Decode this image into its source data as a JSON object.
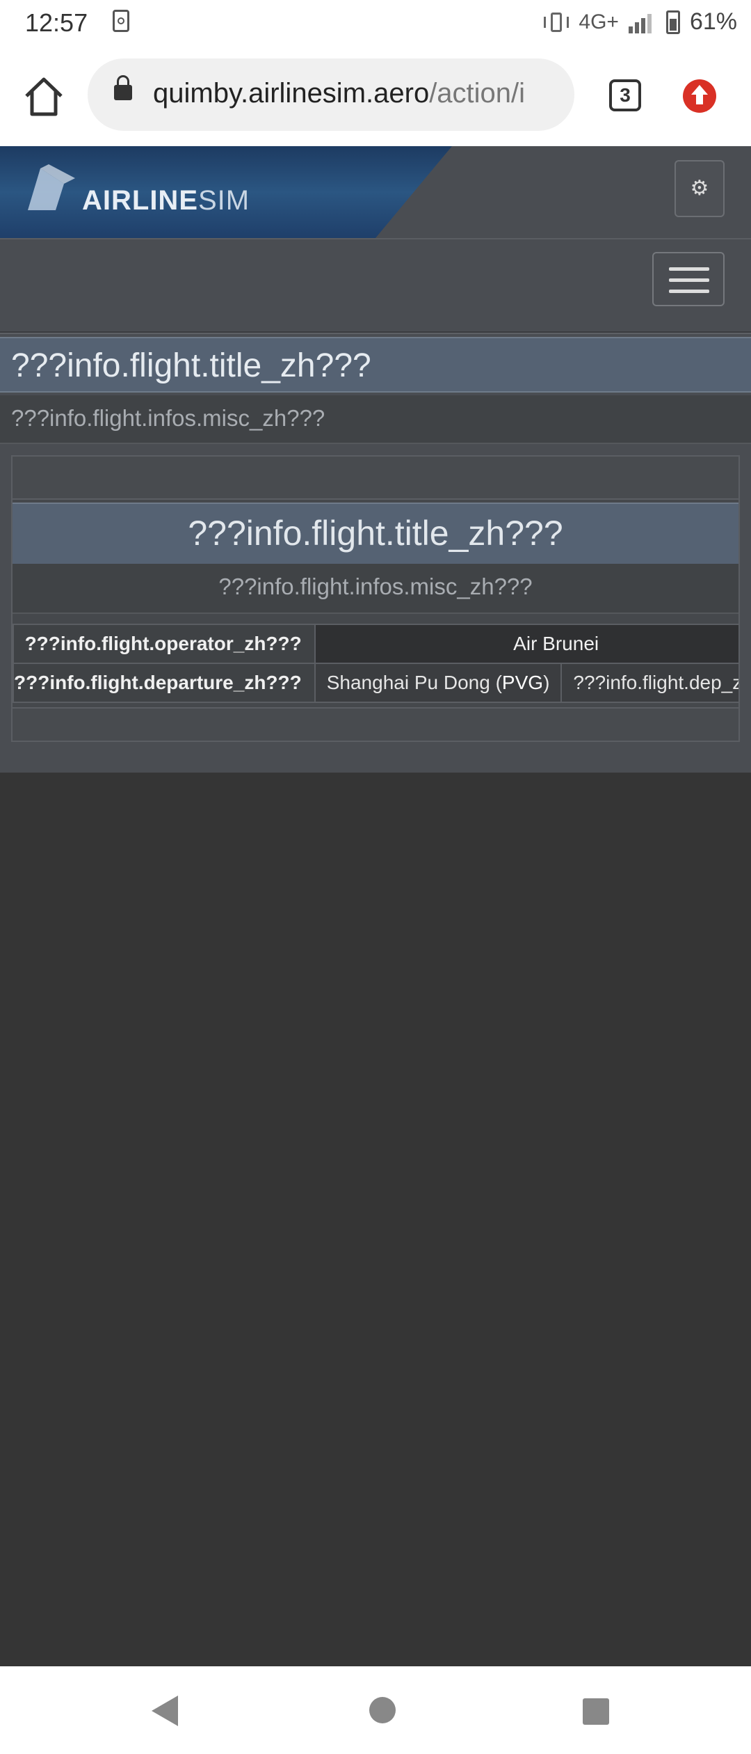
{
  "status_bar": {
    "time": "12:57",
    "network": "4G+",
    "battery": "61%",
    "icons": [
      "sim-card-icon",
      "vibrate-icon",
      "signal-icon",
      "battery-icon"
    ]
  },
  "browser": {
    "url_host": "quimby.airlinesim.aero",
    "url_path": "/action/i",
    "tab_count": "3",
    "icons": [
      "home-icon",
      "lock-icon",
      "tabs-icon",
      "update-icon"
    ]
  },
  "site": {
    "logo_text_bold": "AIRLINE",
    "logo_text_thin": "SIM",
    "settings_icon": "gear-icon",
    "menu_icon": "hamburger-icon",
    "colors": {
      "header_bg": "#4a4d52",
      "logo_band": "#2b5682",
      "title_bar": "#556273",
      "page_bg": "#353535"
    }
  },
  "panel": {
    "title": "???info.flight.title_zh???",
    "subtitle": "???info.flight.infos.misc_zh???"
  },
  "inner": {
    "title": "???info.flight.title_zh???",
    "subtitle": "???info.flight.infos.misc_zh???",
    "rows": [
      {
        "label": "???info.flight.operator_zh???",
        "value": "Air Brunei"
      },
      {
        "label": "???info.flight.departure_zh???",
        "value_prefix": "Shanghai Pu Dong (",
        "value_code": "PVG",
        "value_suffix": ")",
        "extra": "???info.flight.dep_zh???"
      }
    ]
  },
  "system_nav": {
    "icons": [
      "back-icon",
      "home-circle-icon",
      "recents-icon"
    ]
  }
}
